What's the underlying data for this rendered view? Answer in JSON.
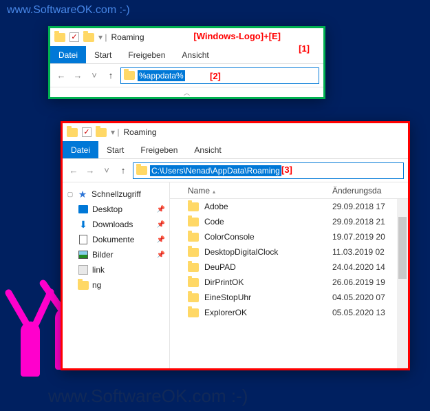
{
  "watermarks": {
    "top": "www.SoftwareOK.com :-)",
    "side": "www.SoftwareOK.com :-)",
    "bottom": "www.SoftwareOK.com :-)"
  },
  "window_green": {
    "title": "Roaming",
    "ribbon": {
      "file": "Datei",
      "start": "Start",
      "share": "Freigeben",
      "view": "Ansicht"
    },
    "address_value": "%appdata%",
    "annotation_shortcut": "[Windows-Logo]+[E]",
    "annotation_num1": "[1]",
    "annotation_num2": "[2]"
  },
  "window_red": {
    "title": "Roaming",
    "ribbon": {
      "file": "Datei",
      "start": "Start",
      "share": "Freigeben",
      "view": "Ansicht"
    },
    "address_value": "C:\\Users\\Nenad\\AppData\\Roaming",
    "annotation_num3": "[3]",
    "nav": {
      "quick_access": "Schnellzugriff",
      "items": [
        {
          "label": "Desktop",
          "icon": "desktop",
          "pinned": true
        },
        {
          "label": "Downloads",
          "icon": "download",
          "pinned": true
        },
        {
          "label": "Dokumente",
          "icon": "doc",
          "pinned": true
        },
        {
          "label": "Bilder",
          "icon": "pic",
          "pinned": true
        },
        {
          "label": "link",
          "icon": "link",
          "pinned": false
        },
        {
          "label": "ng",
          "icon": "folder",
          "pinned": false
        }
      ]
    },
    "columns": {
      "name": "Name",
      "date": "Änderungsda"
    },
    "files": [
      {
        "name": "Adobe",
        "date": "29.09.2018 17"
      },
      {
        "name": "Code",
        "date": "29.09.2018 21"
      },
      {
        "name": "ColorConsole",
        "date": "19.07.2019 20"
      },
      {
        "name": "DesktopDigitalClock",
        "date": "11.03.2019 02"
      },
      {
        "name": "DeuPAD",
        "date": "24.04.2020 14"
      },
      {
        "name": "DirPrintOK",
        "date": "26.06.2019 19"
      },
      {
        "name": "EineStopUhr",
        "date": "04.05.2020 07"
      },
      {
        "name": "ExplorerOK",
        "date": "05.05.2020 13"
      }
    ]
  }
}
